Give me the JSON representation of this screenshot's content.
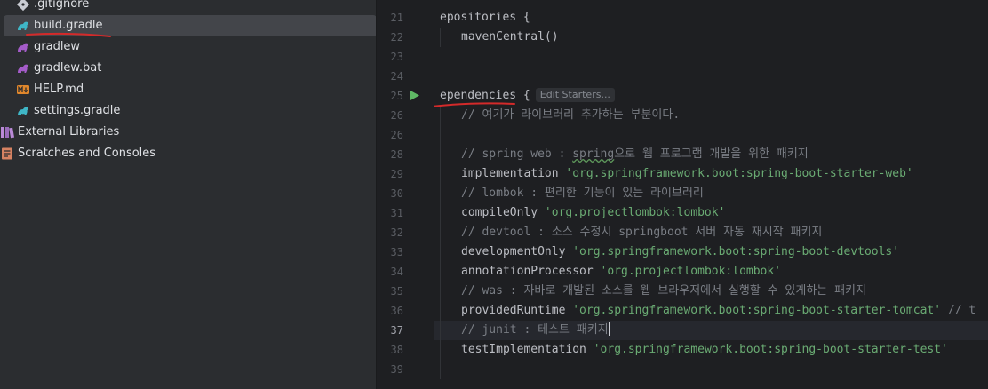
{
  "project_tree": {
    "items": [
      {
        "label": ".gitignore",
        "icon": "git-ignore-icon"
      },
      {
        "label": "build.gradle",
        "icon": "gradle-icon",
        "selected": true
      },
      {
        "label": "gradlew",
        "icon": "gradle-script-icon"
      },
      {
        "label": "gradlew.bat",
        "icon": "gradle-script-icon"
      },
      {
        "label": "HELP.md",
        "icon": "markdown-icon"
      },
      {
        "label": "settings.gradle",
        "icon": "gradle-icon"
      },
      {
        "label": "External Libraries",
        "icon": "libraries-icon"
      },
      {
        "label": "Scratches and Consoles",
        "icon": "scratches-icon"
      }
    ]
  },
  "editor": {
    "current_line": "37",
    "run_gutter_line": "25",
    "inlay_hint": "Edit Starters...",
    "lines": [
      {
        "n": "21",
        "text": "epositories {"
      },
      {
        "n": "22",
        "text": "mavenCentral()"
      },
      {
        "n": "23",
        "text": ""
      },
      {
        "n": "24",
        "text": ""
      },
      {
        "n": "25",
        "text": "ependencies {"
      },
      {
        "n": "26",
        "text": "// 여기가 라이브러리 추가하는 부분이다."
      },
      {
        "n": "26",
        "text": ""
      },
      {
        "n": "28",
        "kw": "// spring web : ",
        "squig": "spring",
        "rest": "으로 웹 프로그램 개발을 위한 패키지"
      },
      {
        "n": "29",
        "code": "implementation ",
        "str": "'org.springframework.boot:spring-boot-starter-web'"
      },
      {
        "n": "30",
        "text": "// lombok : 편리한 기능이 있는 라이브러리"
      },
      {
        "n": "31",
        "code": "compileOnly ",
        "str": "'org.projectlombok:lombok'"
      },
      {
        "n": "32",
        "text": "// devtool : 소스 수정시 springboot 서버 자동 재시작 패키지"
      },
      {
        "n": "33",
        "code": "developmentOnly ",
        "str": "'org.springframework.boot:spring-boot-devtools'"
      },
      {
        "n": "34",
        "code": "annotationProcessor ",
        "str": "'org.projectlombok:lombok'"
      },
      {
        "n": "35",
        "text": "// was : 자바로 개발된 소스를 웹 브라우저에서 실행할 수 있게하는 패키지"
      },
      {
        "n": "36",
        "code": "providedRuntime ",
        "str": "'org.springframework.boot:spring-boot-starter-tomcat'",
        "tail": " // t"
      },
      {
        "n": "37",
        "text": "// junit : 테스트 패키지"
      },
      {
        "n": "38",
        "code": "testImplementation ",
        "str": "'org.springframework.boot:spring-boot-starter-test'"
      },
      {
        "n": "39",
        "text": ""
      }
    ]
  },
  "colors": {
    "tree_bg": "#2b2d30",
    "editor_bg": "#1e1f22",
    "selection": "#43454a",
    "string": "#6aab73",
    "comment": "#7a7e85",
    "annotation_red": "#d42a2a",
    "run_green": "#5fb865"
  }
}
